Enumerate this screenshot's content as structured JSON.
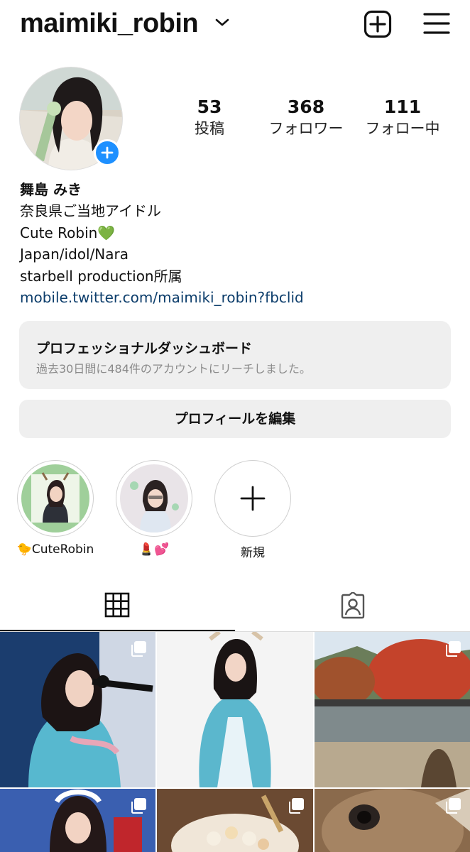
{
  "header": {
    "username": "maimiki_robin",
    "dropdown_icon": "chevron-down-icon",
    "new_post_icon": "plus-square-icon",
    "menu_icon": "hamburger-menu-icon"
  },
  "profile": {
    "avatar_add_icon": "plus-icon",
    "stats": [
      {
        "value": "53",
        "label": "投稿"
      },
      {
        "value": "368",
        "label": "フォロワー"
      },
      {
        "value": "111",
        "label": "フォロー中"
      }
    ]
  },
  "bio": {
    "name": "舞島 みき",
    "lines": [
      "奈良県ご当地アイドル",
      "Cute Robin💚",
      "Japan/idol/Nara",
      "starbell production所属"
    ],
    "link": "mobile.twitter.com/maimiki_robin?fbclid"
  },
  "dashboard": {
    "title": "プロフェッショナルダッシュボード",
    "subtitle": "過去30日間に484件のアカウントにリーチしました。"
  },
  "edit_profile_label": "プロフィールを編集",
  "highlights": [
    {
      "label": "🐤CuteRobin"
    },
    {
      "label": "💄💕"
    },
    {
      "label": "新規"
    }
  ],
  "tabs": [
    {
      "name": "grid",
      "icon": "grid-icon",
      "active": true
    },
    {
      "name": "tagged",
      "icon": "tagged-person-icon",
      "active": false
    }
  ],
  "colors": {
    "accent_blue": "#1e90ff",
    "link": "#0c3d6b",
    "button_bg": "#efefef",
    "muted_text": "#8a8a8a"
  }
}
